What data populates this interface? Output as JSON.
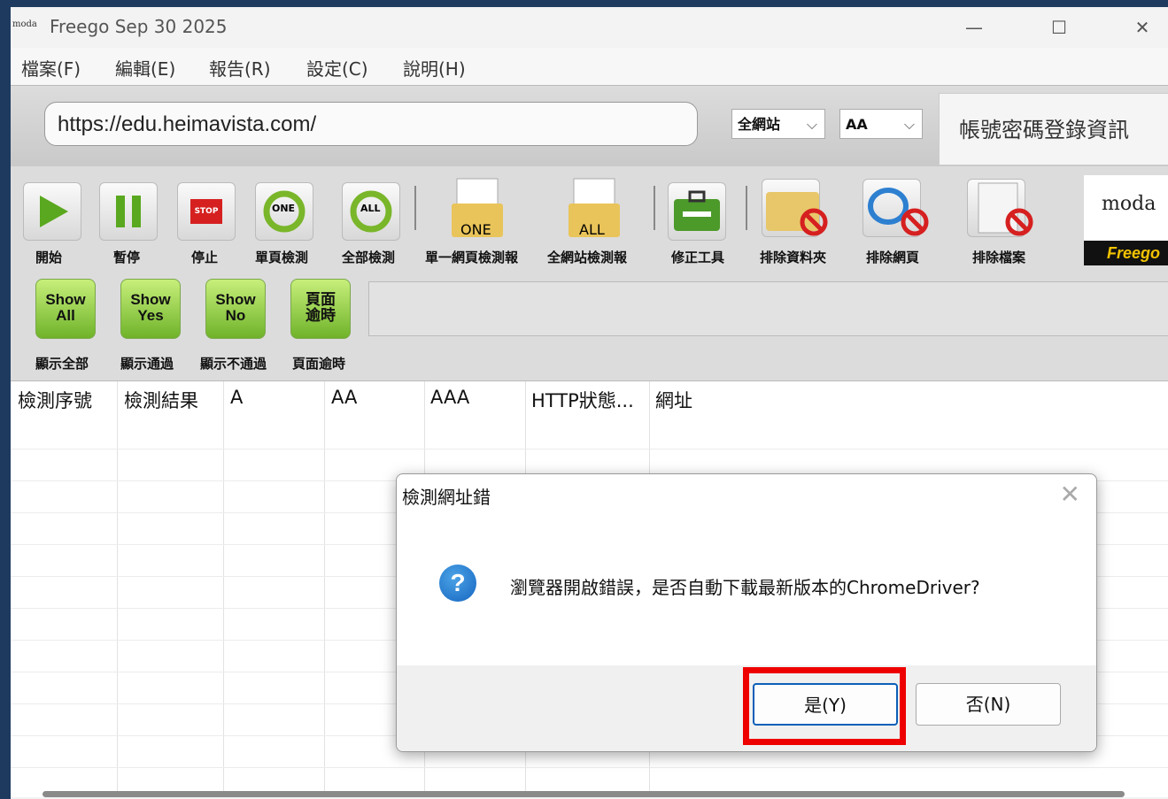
{
  "window": {
    "logo_text": "moda",
    "title": "Freego Sep 30 2025",
    "controls": {
      "minimize": "—",
      "maximize": "☐",
      "close": "✕"
    }
  },
  "menu": [
    {
      "label": "檔案(F)"
    },
    {
      "label": "編輯(E)"
    },
    {
      "label": "報告(R)"
    },
    {
      "label": "設定(C)"
    },
    {
      "label": "說明(H)"
    }
  ],
  "address": {
    "url": "https://edu.heimavista.com/",
    "scope_select": "全網站",
    "level_select": "AA",
    "login_panel": "帳號密碼登錄資訊"
  },
  "toolbar": {
    "buttons": [
      {
        "label": "開始",
        "icon": "play-icon"
      },
      {
        "label": "暫停",
        "icon": "pause-icon"
      },
      {
        "label": "停止",
        "icon": "stop-icon",
        "icon_text": "STOP"
      },
      {
        "label": "單頁檢測",
        "icon": "refresh-one-icon",
        "icon_text": "ONE"
      },
      {
        "label": "全部檢測",
        "icon": "refresh-all-icon",
        "icon_text": "ALL"
      },
      {
        "label": "單一網頁檢測報",
        "icon": "report-one-icon",
        "icon_text": "ONE"
      },
      {
        "label": "全網站檢測報",
        "icon": "report-all-icon",
        "icon_text": "ALL"
      },
      {
        "label": "修正工具",
        "icon": "toolbox-icon"
      },
      {
        "label": "排除資料夾",
        "icon": "exclude-folder-icon"
      },
      {
        "label": "排除網頁",
        "icon": "exclude-webpage-icon"
      },
      {
        "label": "排除檔案",
        "icon": "exclude-file-icon"
      }
    ],
    "filters": [
      {
        "text": "Show\nAll",
        "label": "顯示全部"
      },
      {
        "text": "Show\nYes",
        "label": "顯示通過"
      },
      {
        "text": "Show\nNo",
        "label": "顯示不通過"
      },
      {
        "text": "頁面\n逾時",
        "label": "頁面逾時"
      }
    ],
    "brand": {
      "logo": "moda",
      "name": "Freego"
    }
  },
  "grid": {
    "columns": [
      "檢測序號",
      "檢測結果",
      "A",
      "AA",
      "AAA",
      "HTTP狀態...",
      "網址"
    ]
  },
  "dialog": {
    "title": "檢測網址錯",
    "close": "✕",
    "icon": "question-icon",
    "icon_text": "?",
    "message": "瀏覽器開啟錯誤，是否自動下載最新版本的ChromeDriver?",
    "yes_label": "是(Y)",
    "no_label": "否(N)"
  },
  "colors": {
    "desktop": "#1e3a5f",
    "highlight": "#ee0000",
    "filter_button": "#8fd14f",
    "default_button_border": "#0b5fb8"
  }
}
